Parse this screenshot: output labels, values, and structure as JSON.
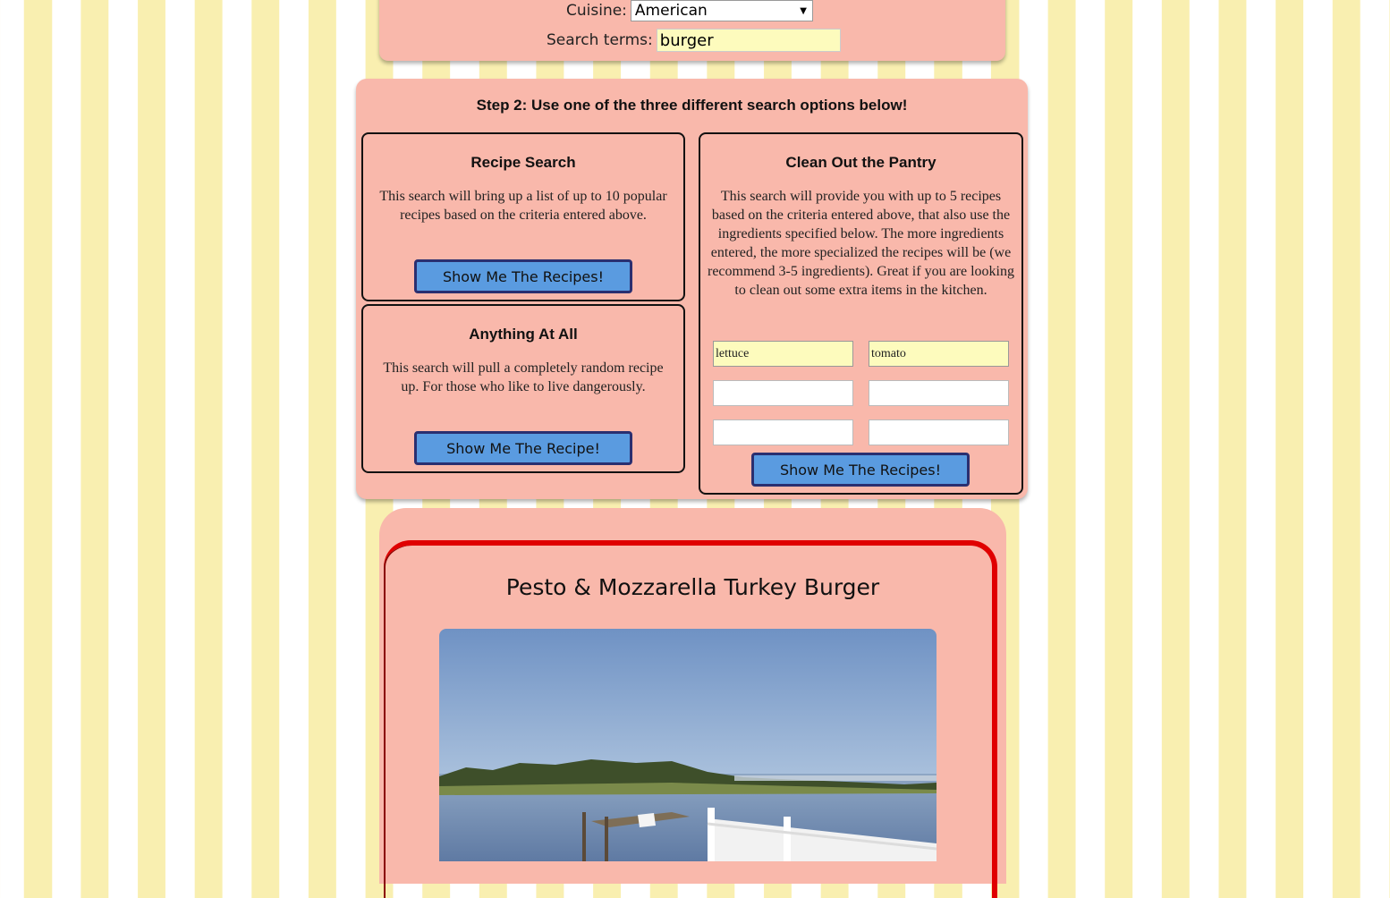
{
  "search": {
    "cuisine_label": "Cuisine:",
    "cuisine_value": "American",
    "terms_label": "Search terms:",
    "terms_value": "burger"
  },
  "step2": {
    "title": "Step 2: Use one of the three different search options below!",
    "recipe_search": {
      "title": "Recipe Search",
      "description": "This search will bring up a list of up to 10 popular recipes based on the criteria entered above.",
      "button": "Show Me The Recipes!"
    },
    "anything": {
      "title": "Anything At All",
      "description": "This search will pull a completely random recipe up. For those who like to live dangerously.",
      "button": "Show Me The Recipe!"
    },
    "pantry": {
      "title": "Clean Out the Pantry",
      "description": "This search will provide you with up to 5 recipes based on the criteria entered above, that also use the ingredients specified below. The more ingredients entered, the more specialized the recipes will be (we recommend 3-5 ingredients). Great if you are looking to clean out some extra items in the kitchen.",
      "ingredients": [
        "lettuce",
        "tomato",
        "",
        "",
        "",
        ""
      ],
      "button": "Show Me The Recipes!"
    }
  },
  "result": {
    "title": "Pesto & Mozzarella Turkey Burger"
  }
}
